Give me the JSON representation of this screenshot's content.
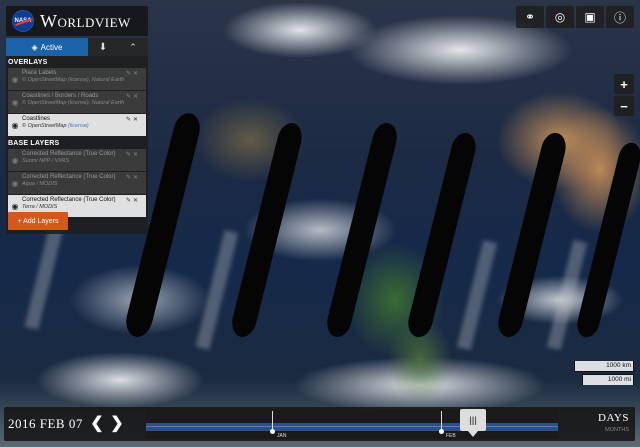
{
  "app": {
    "title": "Worldview",
    "logo_text": "NASA"
  },
  "sidebar": {
    "tabs": {
      "active_label": "Active"
    },
    "overlays_title": "OVERLAYS",
    "base_layers_title": "BASE LAYERS",
    "overlays": [
      {
        "name": "Place Labels",
        "source": "© OpenStreetMap (license), Natural Earth",
        "visible": false
      },
      {
        "name": "Coastlines / Borders / Roads",
        "source": "© OpenStreetMap (license), Natural Earth",
        "visible": false
      },
      {
        "name": "Coastlines",
        "source": "© OpenStreetMap",
        "license": "(license)",
        "visible": true
      }
    ],
    "base_layers": [
      {
        "name": "Corrected Reflectance (True Color)",
        "source": "Suomi NPP / VIIRS",
        "visible": false
      },
      {
        "name": "Corrected Reflectance (True Color)",
        "source": "Aqua / MODIS",
        "visible": false
      },
      {
        "name": "Corrected Reflectance (True Color)",
        "source": "Terra / MODIS",
        "visible": true
      }
    ],
    "add_layers_label": "+ Add Layers"
  },
  "toolbar": {
    "icons": [
      "link-icon",
      "globe-icon",
      "camera-icon",
      "info-icon"
    ]
  },
  "zoom": {
    "in_label": "+",
    "out_label": "−"
  },
  "scale": {
    "km_label": "1000 km",
    "mi_label": "1000 mi"
  },
  "timeline": {
    "date": "2016 FEB 07",
    "zoom_level": "DAYS",
    "zoom_sub": "MONTHS",
    "month_labels": [
      "JAN",
      "FEB"
    ]
  },
  "colors": {
    "accent": "#1b63a8",
    "add_button": "#d4581e",
    "timeline_bar": "#2c4f8a"
  }
}
